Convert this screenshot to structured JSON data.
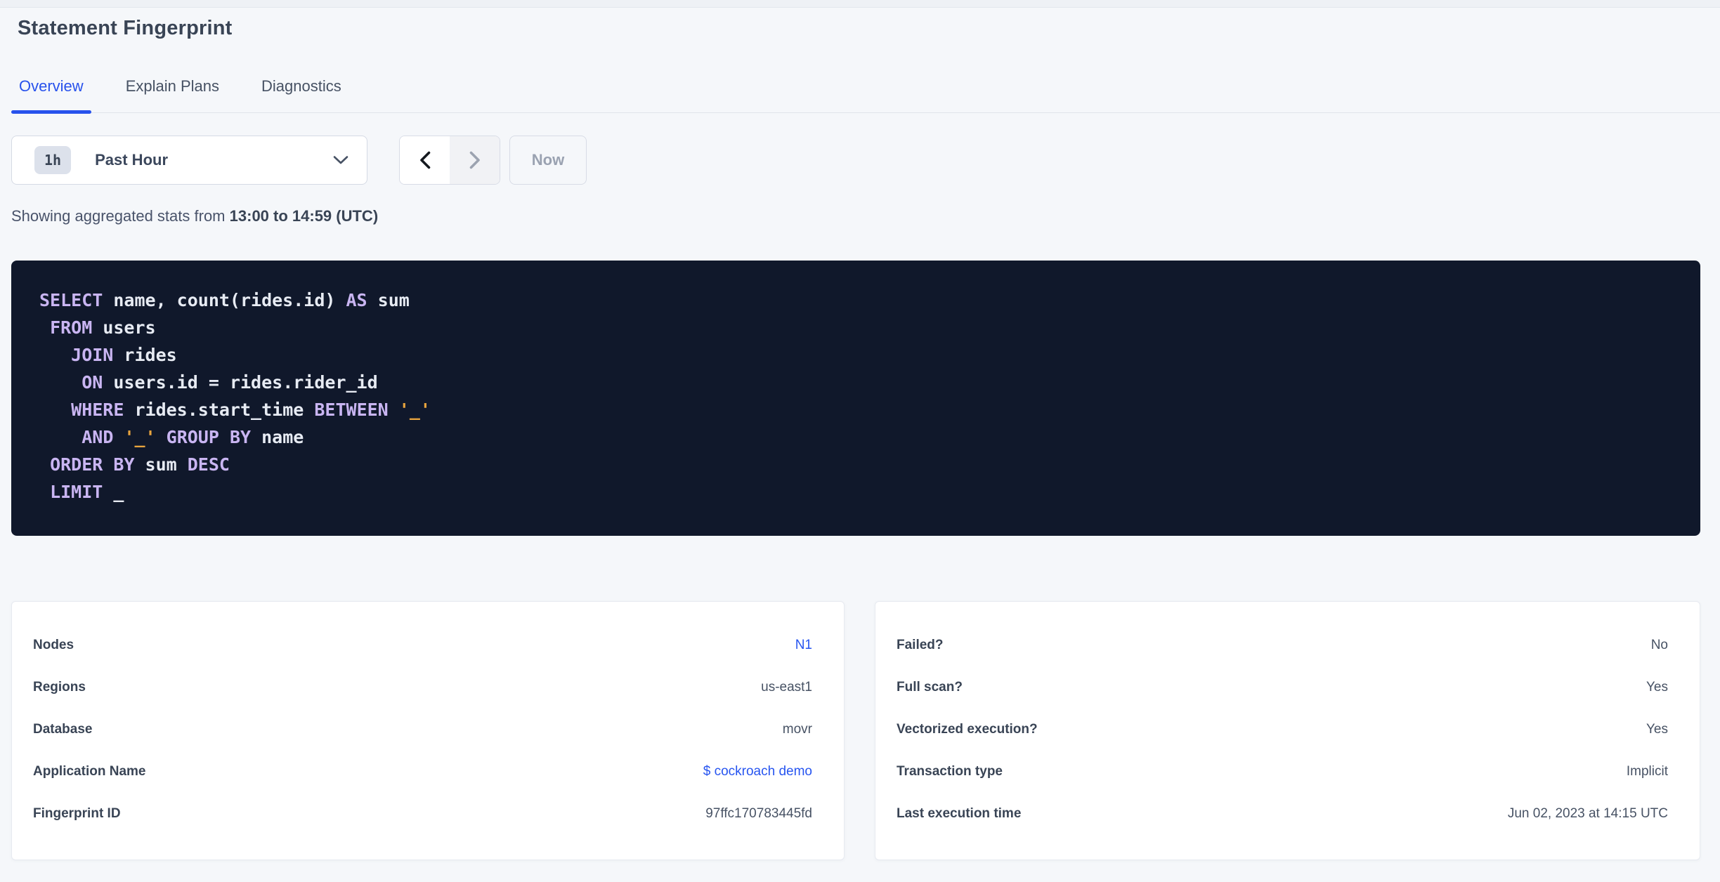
{
  "page": {
    "title": "Statement Fingerprint"
  },
  "tabs": [
    {
      "label": "Overview",
      "active": true
    },
    {
      "label": "Explain Plans",
      "active": false
    },
    {
      "label": "Diagnostics",
      "active": false
    }
  ],
  "time_picker": {
    "interval_badge": "1h",
    "selected_range": "Past Hour",
    "now_label": "Now",
    "prev_enabled": true,
    "next_enabled": false,
    "icons": [
      "chevron-down-icon",
      "chevron-left-icon",
      "chevron-right-icon"
    ]
  },
  "stats": {
    "prefix": "Showing aggregated stats from",
    "range": "13:00 to 14:59 (UTC)"
  },
  "sql": {
    "lines": [
      [
        {
          "t": "SELECT",
          "c": "kw"
        },
        {
          "t": " name, count(rides.id) ",
          "c": "id"
        },
        {
          "t": "AS",
          "c": "kw"
        },
        {
          "t": " sum",
          "c": "id"
        }
      ],
      [
        {
          "t": " ",
          "c": "id"
        },
        {
          "t": "FROM",
          "c": "kw"
        },
        {
          "t": " users",
          "c": "id"
        }
      ],
      [
        {
          "t": "   ",
          "c": "id"
        },
        {
          "t": "JOIN",
          "c": "kw"
        },
        {
          "t": " rides",
          "c": "id"
        }
      ],
      [
        {
          "t": "    ",
          "c": "id"
        },
        {
          "t": "ON",
          "c": "kw"
        },
        {
          "t": " users.id = rides.rider_id",
          "c": "id"
        }
      ],
      [
        {
          "t": "   ",
          "c": "id"
        },
        {
          "t": "WHERE",
          "c": "kw"
        },
        {
          "t": " rides.start_time ",
          "c": "id"
        },
        {
          "t": "BETWEEN",
          "c": "kw"
        },
        {
          "t": " ",
          "c": "id"
        },
        {
          "t": "'_'",
          "c": "str"
        }
      ],
      [
        {
          "t": "    ",
          "c": "id"
        },
        {
          "t": "AND",
          "c": "kw"
        },
        {
          "t": " ",
          "c": "id"
        },
        {
          "t": "'_'",
          "c": "str"
        },
        {
          "t": " ",
          "c": "id"
        },
        {
          "t": "GROUP BY",
          "c": "kw"
        },
        {
          "t": " name",
          "c": "id"
        }
      ],
      [
        {
          "t": " ",
          "c": "id"
        },
        {
          "t": "ORDER BY",
          "c": "kw"
        },
        {
          "t": " sum ",
          "c": "id"
        },
        {
          "t": "DESC",
          "c": "kw"
        }
      ],
      [
        {
          "t": " ",
          "c": "id"
        },
        {
          "t": "LIMIT",
          "c": "kw"
        },
        {
          "t": " _",
          "c": "id"
        }
      ]
    ]
  },
  "cards": {
    "left": {
      "rows": [
        {
          "label": "Nodes",
          "value": "N1",
          "link": true
        },
        {
          "label": "Regions",
          "value": "us-east1",
          "link": false
        },
        {
          "label": "Database",
          "value": "movr",
          "link": false
        },
        {
          "label": "Application Name",
          "value": "$ cockroach demo",
          "link": true
        },
        {
          "label": "Fingerprint ID",
          "value": "97ffc170783445fd",
          "link": false
        }
      ]
    },
    "right": {
      "rows": [
        {
          "label": "Failed?",
          "value": "No",
          "link": false
        },
        {
          "label": "Full scan?",
          "value": "Yes",
          "link": false
        },
        {
          "label": "Vectorized execution?",
          "value": "Yes",
          "link": false
        },
        {
          "label": "Transaction type",
          "value": "Implicit",
          "link": false
        },
        {
          "label": "Last execution time",
          "value": "Jun 02, 2023 at 14:15 UTC",
          "link": false
        }
      ]
    }
  },
  "colors": {
    "accent_blue": "#2852EC",
    "link_blue": "#2755F0",
    "page_bg": "#F5F7FA",
    "code_bg": "#10182B",
    "code_keyword": "#C9B5F2",
    "code_string": "#E8A43E",
    "code_text": "#E7EBF3",
    "text_dark": "#394455",
    "text_muted": "#475264"
  }
}
